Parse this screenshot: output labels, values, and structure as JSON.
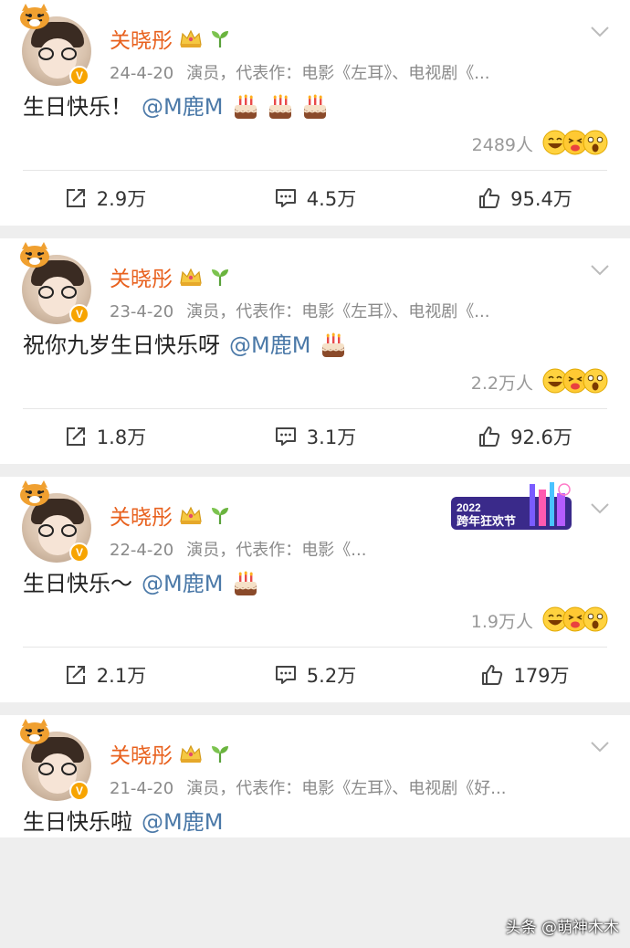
{
  "posts": [
    {
      "username": "关晓彤",
      "date": "24-4-20",
      "bio": "演员，代表作：电影《左耳》、电视剧《...",
      "text": "生日快乐！",
      "mention": "@M鹿M",
      "cake_count": 3,
      "reaction_count": "2489人",
      "repost": "2.9万",
      "comment": "4.5万",
      "like": "95.4万",
      "event_banner": false
    },
    {
      "username": "关晓彤",
      "date": "23-4-20",
      "bio": "演员，代表作：电影《左耳》、电视剧《...",
      "text": "祝你九岁生日快乐呀",
      "mention": "@M鹿M",
      "cake_count": 1,
      "reaction_count": "2.2万人",
      "repost": "1.8万",
      "comment": "3.1万",
      "like": "92.6万",
      "event_banner": false
    },
    {
      "username": "关晓彤",
      "date": "22-4-20",
      "bio": "演员，代表作：电影《...",
      "text": "生日快乐～",
      "mention": "@M鹿M",
      "cake_count": 1,
      "reaction_count": "1.9万人",
      "repost": "2.1万",
      "comment": "5.2万",
      "like": "179万",
      "event_banner": true,
      "banner_year": "2022",
      "banner_text": "跨年狂欢节"
    },
    {
      "username": "关晓彤",
      "date": "21-4-20",
      "bio": "演员，代表作：电影《左耳》、电视剧《好...",
      "text": "生日快乐啦",
      "mention": "@M鹿M",
      "cake_count": 0
    }
  ],
  "watermark": "头条 @萌神木木",
  "icons": {
    "repost": "repost-icon",
    "comment": "comment-icon",
    "like": "thumbs-up-icon",
    "crown": "crown-icon",
    "sprout": "sprout-icon",
    "verified": "verified-v-icon",
    "reactions": "laugh-emoji-icons"
  },
  "colors": {
    "username": "#e8611e",
    "mention": "#4b79a8",
    "meta": "#8a8a8a",
    "verified": "#f7a400"
  }
}
